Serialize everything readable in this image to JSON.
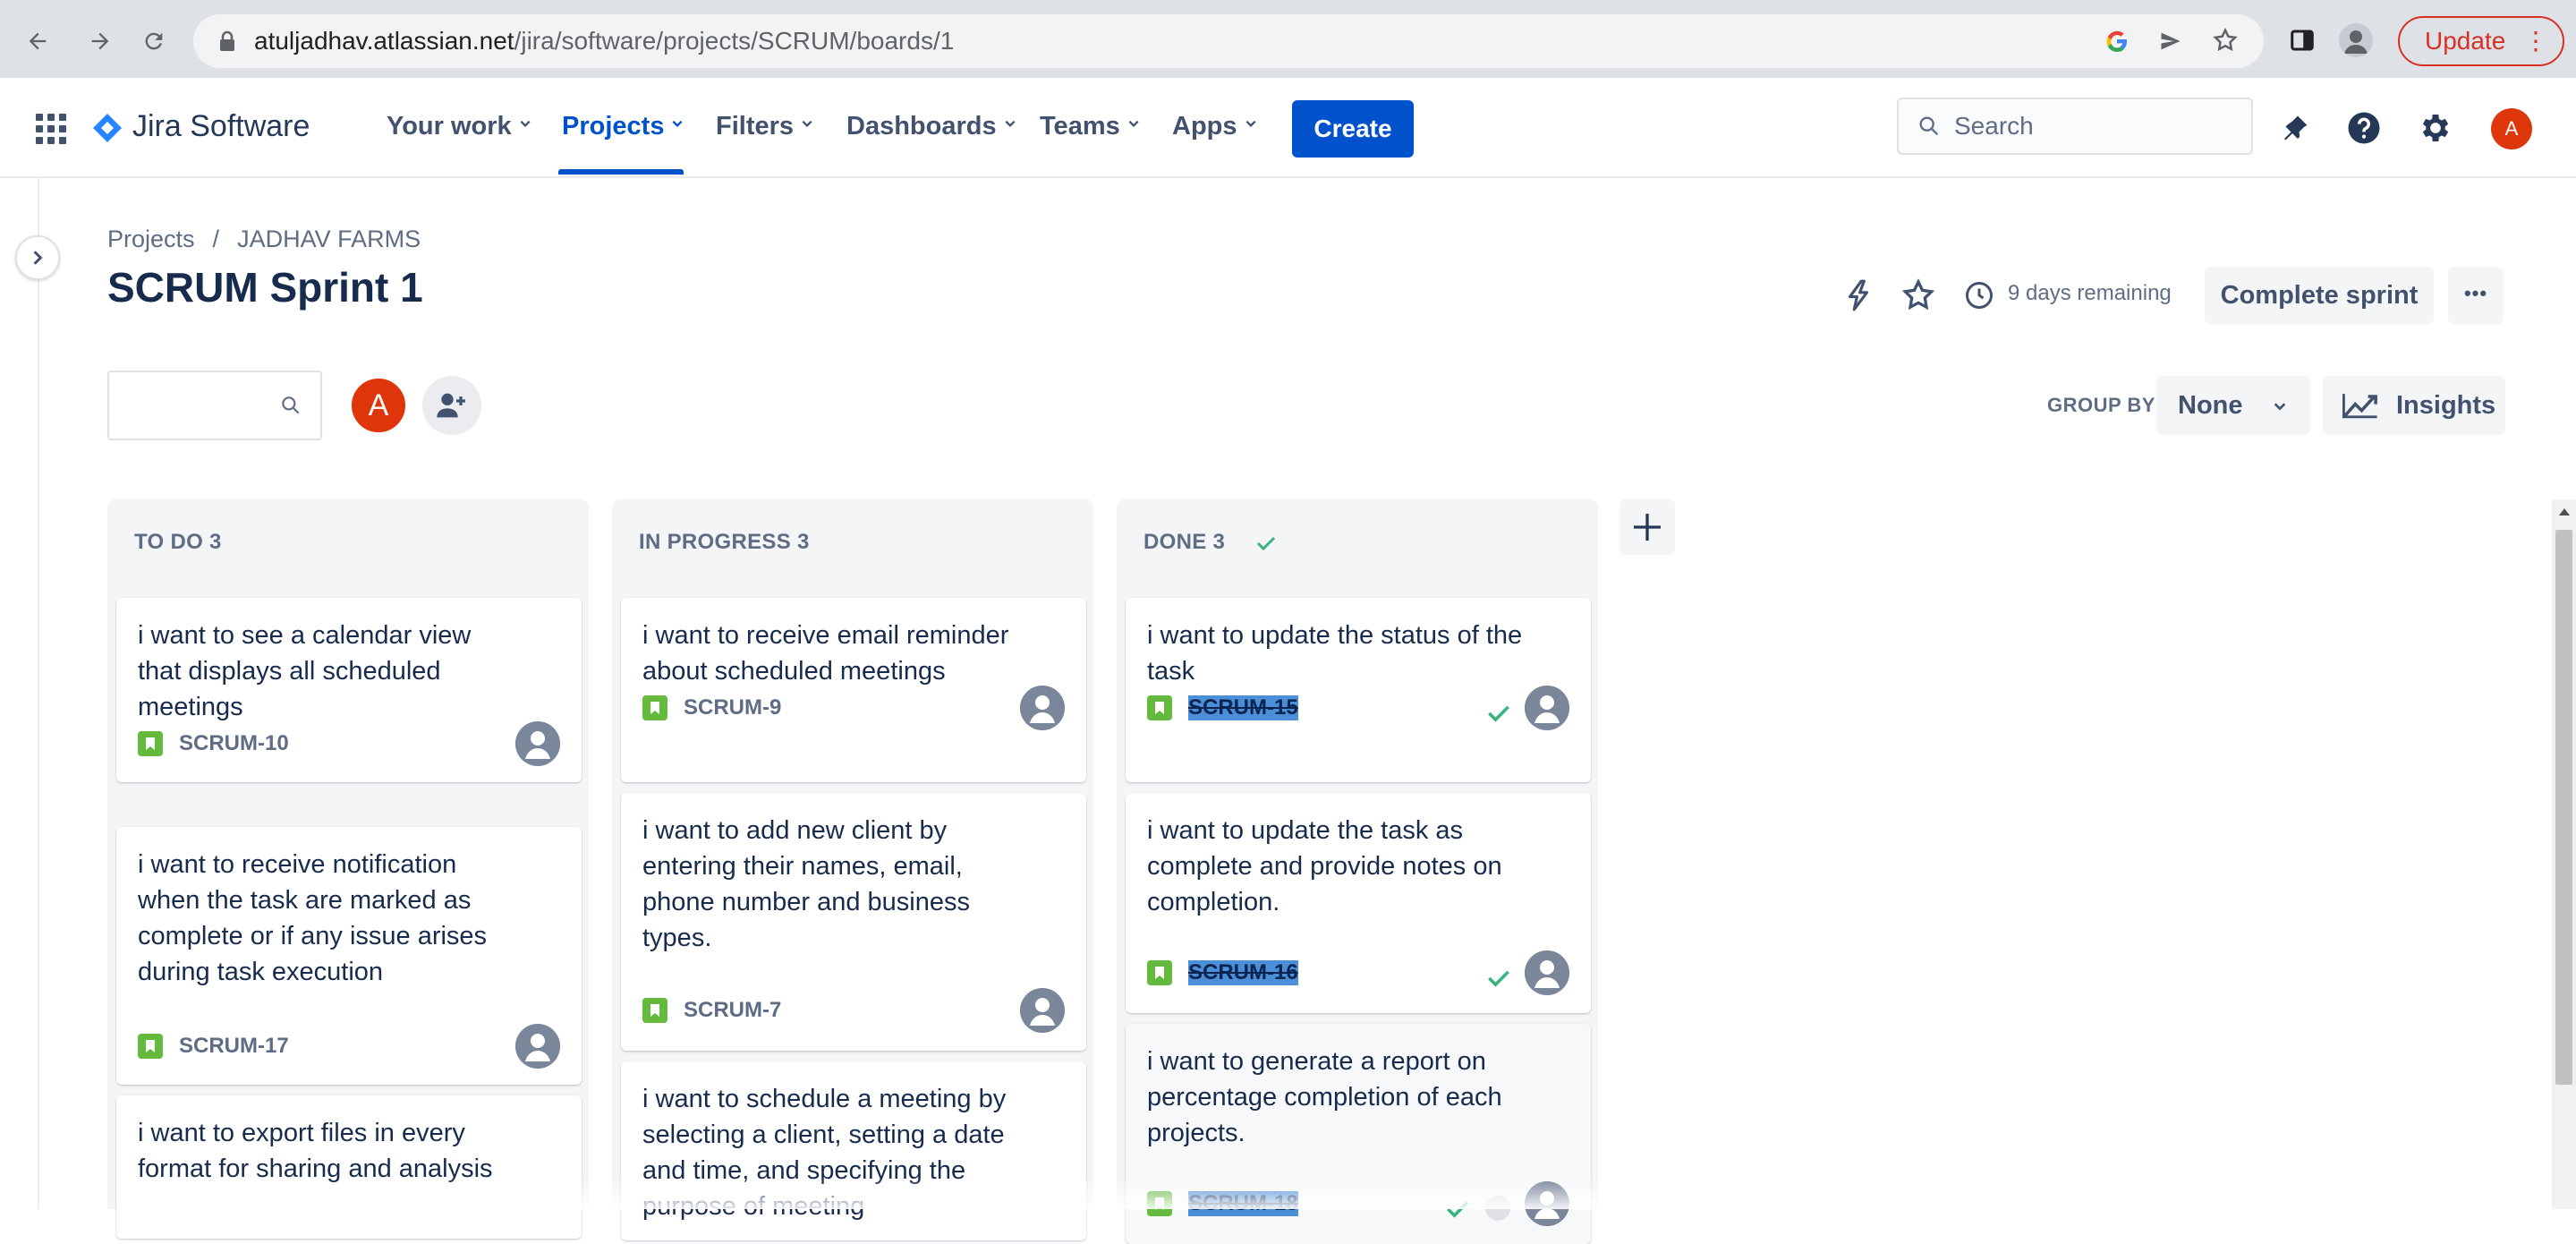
{
  "browser": {
    "url_host": "atuljadhav.atlassian.net",
    "url_path": "/jira/software/projects/SCRUM/boards/1",
    "update_label": "Update"
  },
  "nav": {
    "product": "Jira Software",
    "items": [
      {
        "label": "Your work"
      },
      {
        "label": "Projects"
      },
      {
        "label": "Filters"
      },
      {
        "label": "Dashboards"
      },
      {
        "label": "Teams"
      },
      {
        "label": "Apps"
      }
    ],
    "create_label": "Create",
    "search_placeholder": "Search",
    "user_initial": "A"
  },
  "breadcrumb": {
    "root": "Projects",
    "sep": "/",
    "project": "JADHAV FARMS"
  },
  "sprint": {
    "title": "SCRUM Sprint 1",
    "remaining": "9 days remaining",
    "complete_label": "Complete sprint",
    "more_label": "•••"
  },
  "toolbar": {
    "avatar_initial": "A",
    "group_by_label": "GROUP BY",
    "group_by_value": "None",
    "insights_label": "Insights"
  },
  "columns": [
    {
      "title": "TO DO 3",
      "cards": [
        {
          "summary": "i want to see a calendar view that displays all scheduled meetings",
          "key": "SCRUM-10"
        },
        {
          "summary": "i want to receive notification when the task are marked as complete or if any issue arises during task execution",
          "key": "SCRUM-17"
        },
        {
          "summary": "i want to export files in every format for sharing and analysis",
          "key": ""
        }
      ]
    },
    {
      "title": "IN PROGRESS 3",
      "cards": [
        {
          "summary": "i want to receive email reminder about scheduled meetings",
          "key": "SCRUM-9"
        },
        {
          "summary": "i want to add new client by entering their names, email, phone number and business types.",
          "key": "SCRUM-7"
        },
        {
          "summary": "i want to schedule a meeting by selecting a client, setting a date and time, and specifying the purpose of meeting",
          "key": ""
        }
      ]
    },
    {
      "title": "DONE 3",
      "cards": [
        {
          "summary": "i want to update the status of the task",
          "key": "SCRUM-15"
        },
        {
          "summary": "i want to update the task as complete and provide notes on completion.",
          "key": "SCRUM-16"
        },
        {
          "summary": "i want to generate a report on percentage completion of each projects.",
          "key": "SCRUM-18"
        }
      ]
    }
  ],
  "colors": {
    "brand": "#0052cc",
    "story": "#63ba3c",
    "done_check": "#36b37e",
    "avatar": "#de350b"
  }
}
